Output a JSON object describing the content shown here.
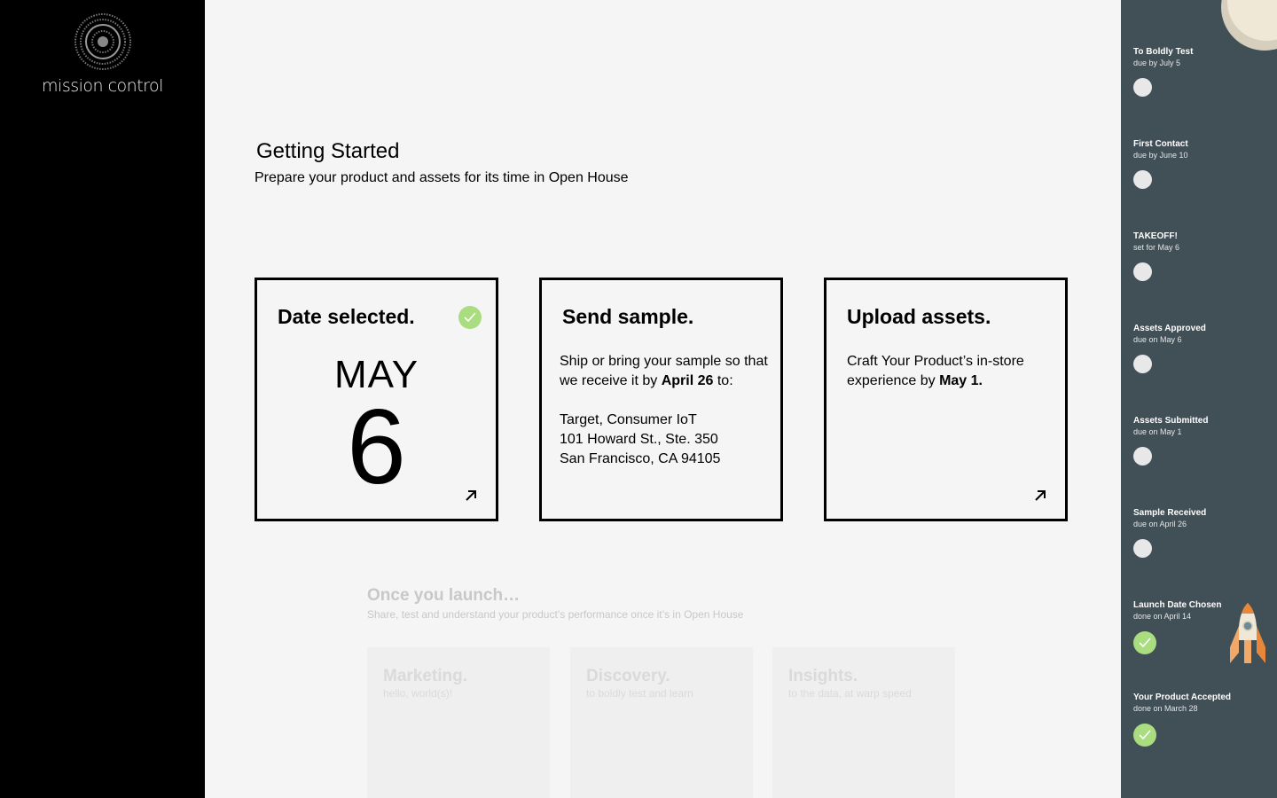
{
  "app": {
    "logo_text": "mission control"
  },
  "main": {
    "title": "Getting Started",
    "subtitle": "Prepare your product and assets for its time in Open House",
    "cards": [
      {
        "title": "Date selected.",
        "month": "MAY",
        "day": "6",
        "status": "complete"
      },
      {
        "title": "Send sample.",
        "body_pre": "Ship or bring your sample so that we receive it by ",
        "body_bold": "April 26",
        "body_post": " to:",
        "address": [
          "Target, Consumer IoT",
          "101 Howard St., Ste. 350",
          "San Francisco, CA 94105"
        ]
      },
      {
        "title": "Upload assets.",
        "body_pre": "Craft Your Product’s in-store experience by ",
        "body_bold": "May 1."
      }
    ],
    "launch": {
      "title": "Once you launch…",
      "subtitle": "Share, test and understand your product’s performance once it’s in Open House",
      "cards": [
        {
          "title": "Marketing.",
          "subtitle": "hello, world(s)!"
        },
        {
          "title": "Discovery.",
          "subtitle": "to boldly test and learn"
        },
        {
          "title": "Insights.",
          "subtitle": "to the data, at warp speed"
        }
      ]
    }
  },
  "timeline": [
    {
      "title": "To Boldly Test",
      "subtitle": "due by July 5",
      "status": "pending"
    },
    {
      "title": "First Contact",
      "subtitle": "due by June 10",
      "status": "pending"
    },
    {
      "title": "TAKEOFF!",
      "subtitle": "set for May 6",
      "status": "pending"
    },
    {
      "title": "Assets Approved",
      "subtitle": "due on May 6",
      "status": "pending"
    },
    {
      "title": "Assets Submitted",
      "subtitle": "due on May 1",
      "status": "pending"
    },
    {
      "title": "Sample Received",
      "subtitle": "due on April 26",
      "status": "pending"
    },
    {
      "title": "Launch Date Chosen",
      "subtitle": "done on April 14",
      "status": "done"
    },
    {
      "title": "Your Product Accepted",
      "subtitle": "done on March 28",
      "status": "done"
    }
  ],
  "colors": {
    "accent_green": "#a9dd7f",
    "sidebar_dark": "#414f57",
    "left_bg": "#000000"
  },
  "icons": [
    "target-logo-icon",
    "check-icon",
    "arrow-up-right-icon",
    "moon-icon",
    "rocket-icon"
  ]
}
